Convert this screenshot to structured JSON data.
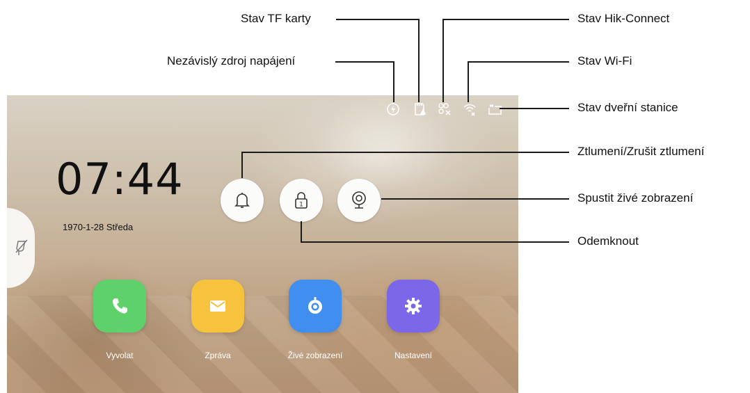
{
  "screen": {
    "clock": "07:44",
    "date": "1970-1-28  Středa",
    "status_icons": [
      "power-supply-icon",
      "tf-card-icon",
      "hik-connect-icon",
      "wifi-icon",
      "door-station-icon"
    ],
    "buttons": {
      "mute": "bell-icon",
      "unlock": "lock-icon",
      "unlock_number": "1",
      "live_view": "camera-icon"
    },
    "apps": [
      {
        "label": "Vyvolat",
        "icon": "phone-icon",
        "color": "#5fd16a"
      },
      {
        "label": "Zpráva",
        "icon": "envelope-icon",
        "color": "#f7c33e"
      },
      {
        "label": "Živé zobrazení",
        "icon": "live-view-icon",
        "color": "#3f8ef0"
      },
      {
        "label": "Nastavení",
        "icon": "gear-icon",
        "color": "#7b67e8"
      }
    ]
  },
  "callouts": {
    "tf_card": "Stav TF karty",
    "power": "Nezávislý zdroj napájení",
    "hik_connect": "Stav Hik-Connect",
    "wifi": "Stav Wi-Fi",
    "door_station": "Stav dveřní stanice",
    "mute": "Ztlumení/Zrušit ztlumení",
    "live_view": "Spustit živé zobrazení",
    "unlock": "Odemknout"
  }
}
